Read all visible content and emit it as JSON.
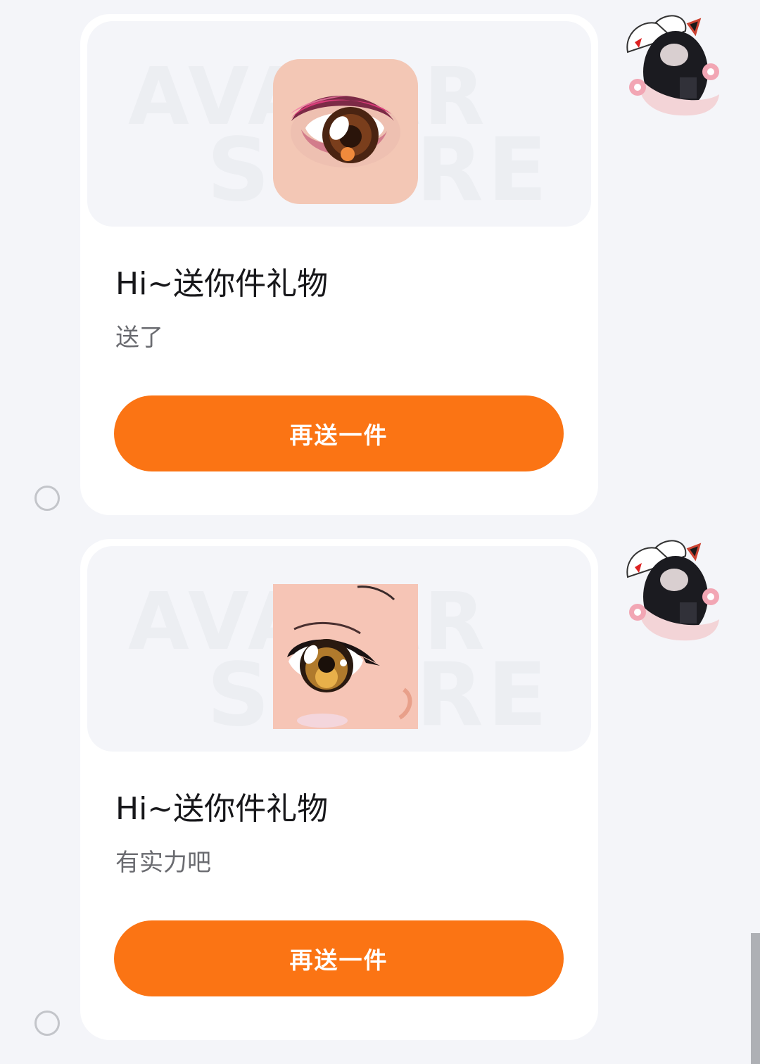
{
  "messages": [
    {
      "title": "Hi~送你件礼物",
      "message": "送了",
      "button_label": "再送一件",
      "watermark_line1": "AVATAR",
      "watermark_line2": "STORE",
      "item_icon": "pink-eyeshadow-eye-icon"
    },
    {
      "title": "Hi~送你件礼物",
      "message": "有实力吧",
      "button_label": "再送一件",
      "watermark_line1": "AVATAR",
      "watermark_line2": "STORE",
      "item_icon": "amber-anime-eye-icon"
    }
  ],
  "sender_avatar_icon": "anime-girl-cat-ears-avatar",
  "colors": {
    "button": "#fb7414",
    "background": "#f4f5f9",
    "card": "#ffffff"
  }
}
